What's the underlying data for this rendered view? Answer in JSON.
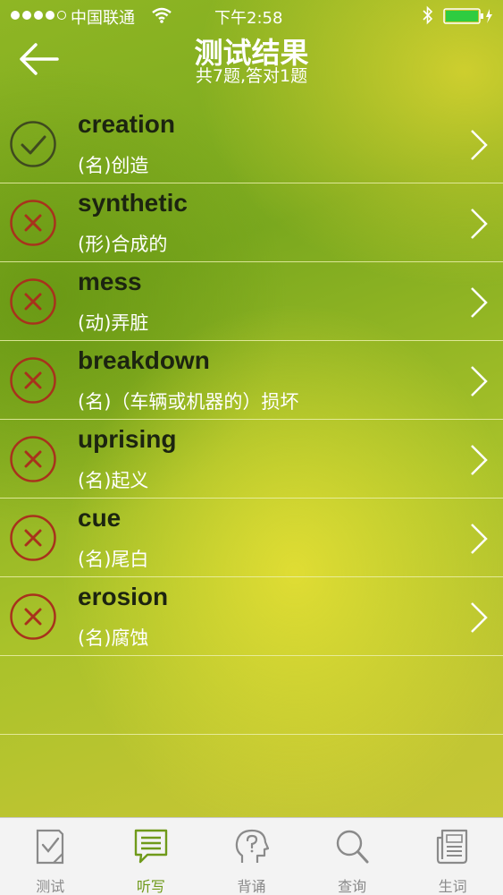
{
  "status_bar": {
    "carrier": "中国联通",
    "time": "下午2:58"
  },
  "header": {
    "title": "测试结果",
    "subtitle": "共7题,答对1题"
  },
  "words": [
    {
      "word": "creation",
      "meaning": "(名)创造",
      "correct": true
    },
    {
      "word": "synthetic",
      "meaning": "(形)合成的",
      "correct": false
    },
    {
      "word": "mess",
      "meaning": "(动)弄脏",
      "correct": false
    },
    {
      "word": "breakdown",
      "meaning": "(名)（车辆或机器的）损坏",
      "correct": false
    },
    {
      "word": "uprising",
      "meaning": "(名)起义",
      "correct": false
    },
    {
      "word": "cue",
      "meaning": "(名)尾白",
      "correct": false
    },
    {
      "word": "erosion",
      "meaning": "(名)腐蚀",
      "correct": false
    }
  ],
  "tabs": [
    {
      "label": "测试",
      "icon": "test-icon"
    },
    {
      "label": "听写",
      "icon": "dictation-icon",
      "active": true
    },
    {
      "label": "背诵",
      "icon": "recite-icon"
    },
    {
      "label": "查询",
      "icon": "search-icon"
    },
    {
      "label": "生词",
      "icon": "vocabulary-icon"
    }
  ],
  "colors": {
    "correct": "#3f4a1f",
    "wrong": "#a8321c",
    "active_tab": "#6f9a1a"
  }
}
